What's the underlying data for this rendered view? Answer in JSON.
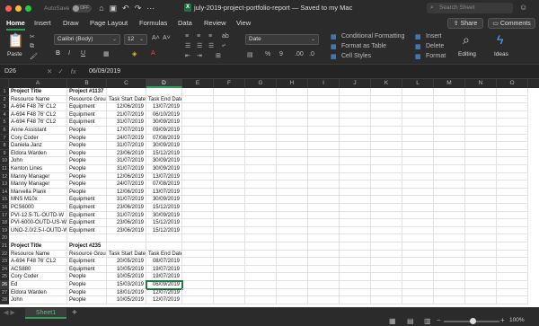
{
  "window": {
    "title": "july-2019-project-portfolio-report — Saved to my Mac",
    "autosave_label": "AutoSave",
    "autosave_state": "OFF",
    "search_placeholder": "Search Sheet"
  },
  "menu": {
    "tabs": [
      "Home",
      "Insert",
      "Draw",
      "Page Layout",
      "Formulas",
      "Data",
      "Review",
      "View"
    ],
    "share_label": "Share",
    "comments_label": "Comments"
  },
  "ribbon": {
    "paste_label": "Paste",
    "font_name": "Calibri (Body)",
    "font_size": "12",
    "number_format": "Date",
    "conditional_formatting": "Conditional Formatting",
    "format_as_table": "Format as Table",
    "cell_styles": "Cell Styles",
    "insert": "Insert",
    "delete": "Delete",
    "format": "Format",
    "editing": "Editing",
    "ideas": "Ideas",
    "percent": "%",
    "comma": "9"
  },
  "formula_bar": {
    "name_box": "D26",
    "fx": "fx",
    "value": "06/09/2019"
  },
  "sheet": {
    "columns": [
      "A",
      "B",
      "C",
      "D",
      "E",
      "F",
      "G",
      "H",
      "I",
      "J",
      "K",
      "L",
      "M",
      "N",
      "O"
    ],
    "active_column": "D",
    "active_row": 26,
    "rows": [
      {
        "n": 1,
        "a": "Project Title",
        "b": "Project #1137",
        "c": "",
        "d": "",
        "bold": true
      },
      {
        "n": 2,
        "a": "Resource Name",
        "b": "Resource Group",
        "c": "Task Start Date",
        "d": "Task End Date"
      },
      {
        "n": 3,
        "a": "A-694 F48 76' CL2",
        "b": "Equipment",
        "c": "12/06/2019",
        "d": "13/07/2019"
      },
      {
        "n": 4,
        "a": "A-694 F48 76' CL2",
        "b": "Equipment",
        "c": "21/07/2019",
        "d": "06/10/2019"
      },
      {
        "n": 5,
        "a": "A-694 F48 76' CL2",
        "b": "Equipment",
        "c": "31/07/2019",
        "d": "30/09/2019"
      },
      {
        "n": 6,
        "a": "Anne Assistant",
        "b": "People",
        "c": "17/07/2019",
        "d": "09/09/2019"
      },
      {
        "n": 7,
        "a": "Cory Coder",
        "b": "People",
        "c": "24/07/2019",
        "d": "07/08/2019"
      },
      {
        "n": 8,
        "a": "Daniela Janz",
        "b": "People",
        "c": "31/07/2019",
        "d": "30/09/2019"
      },
      {
        "n": 9,
        "a": "Eldora Warden",
        "b": "People",
        "c": "23/06/2019",
        "d": "15/12/2019"
      },
      {
        "n": 10,
        "a": "John",
        "b": "People",
        "c": "31/07/2019",
        "d": "30/09/2019"
      },
      {
        "n": 11,
        "a": "Kenton Lines",
        "b": "People",
        "c": "31/07/2019",
        "d": "30/09/2019"
      },
      {
        "n": 12,
        "a": "Manny Manager",
        "b": "People",
        "c": "12/06/2019",
        "d": "13/07/2019"
      },
      {
        "n": 13,
        "a": "Manny Manager",
        "b": "People",
        "c": "24/07/2019",
        "d": "07/08/2019"
      },
      {
        "n": 14,
        "a": "Marvella Plank",
        "b": "People",
        "c": "12/06/2019",
        "d": "13/07/2019"
      },
      {
        "n": 15,
        "a": "MNS M10x",
        "b": "Equipment",
        "c": "31/07/2019",
        "d": "30/09/2019"
      },
      {
        "n": 16,
        "a": "PCS6000",
        "b": "Equipment",
        "c": "23/06/2019",
        "d": "15/12/2019"
      },
      {
        "n": 17,
        "a": "PVI-12.5-TL-OUTD-W",
        "b": "Equipment",
        "c": "31/07/2019",
        "d": "30/09/2019"
      },
      {
        "n": 18,
        "a": "PVI-6000-OUTD-US-W",
        "b": "Equipment",
        "c": "23/06/2019",
        "d": "15/12/2019"
      },
      {
        "n": 19,
        "a": "UNO-2.0/2.5-I-OUTD-W",
        "b": "Equipment",
        "c": "23/06/2019",
        "d": "15/12/2019"
      },
      {
        "n": 20,
        "a": "",
        "b": "",
        "c": "",
        "d": ""
      },
      {
        "n": 21,
        "a": "Project Title",
        "b": "Project #235",
        "c": "",
        "d": "",
        "bold": true
      },
      {
        "n": 22,
        "a": "Resource Name",
        "b": "Resource Group",
        "c": "Task Start Date",
        "d": "Task End Date"
      },
      {
        "n": 23,
        "a": "A-694 F48 76' CL2",
        "b": "Equipment",
        "c": "20/05/2019",
        "d": "08/07/2019"
      },
      {
        "n": 24,
        "a": "ACS880",
        "b": "Equipment",
        "c": "10/05/2019",
        "d": "19/07/2019"
      },
      {
        "n": 25,
        "a": "Cory Coder",
        "b": "People",
        "c": "10/05/2019",
        "d": "19/07/2019"
      },
      {
        "n": 26,
        "a": "Ed",
        "b": "People",
        "c": "15/03/2019",
        "d": "06/09/2019"
      },
      {
        "n": 27,
        "a": "Eldora Warden",
        "b": "People",
        "c": "18/01/2019",
        "d": "12/07/2019"
      },
      {
        "n": 28,
        "a": "John",
        "b": "People",
        "c": "10/05/2019",
        "d": "12/07/2019"
      }
    ]
  },
  "status": {
    "sheet_tab": "Sheet1",
    "zoom": "100%"
  }
}
